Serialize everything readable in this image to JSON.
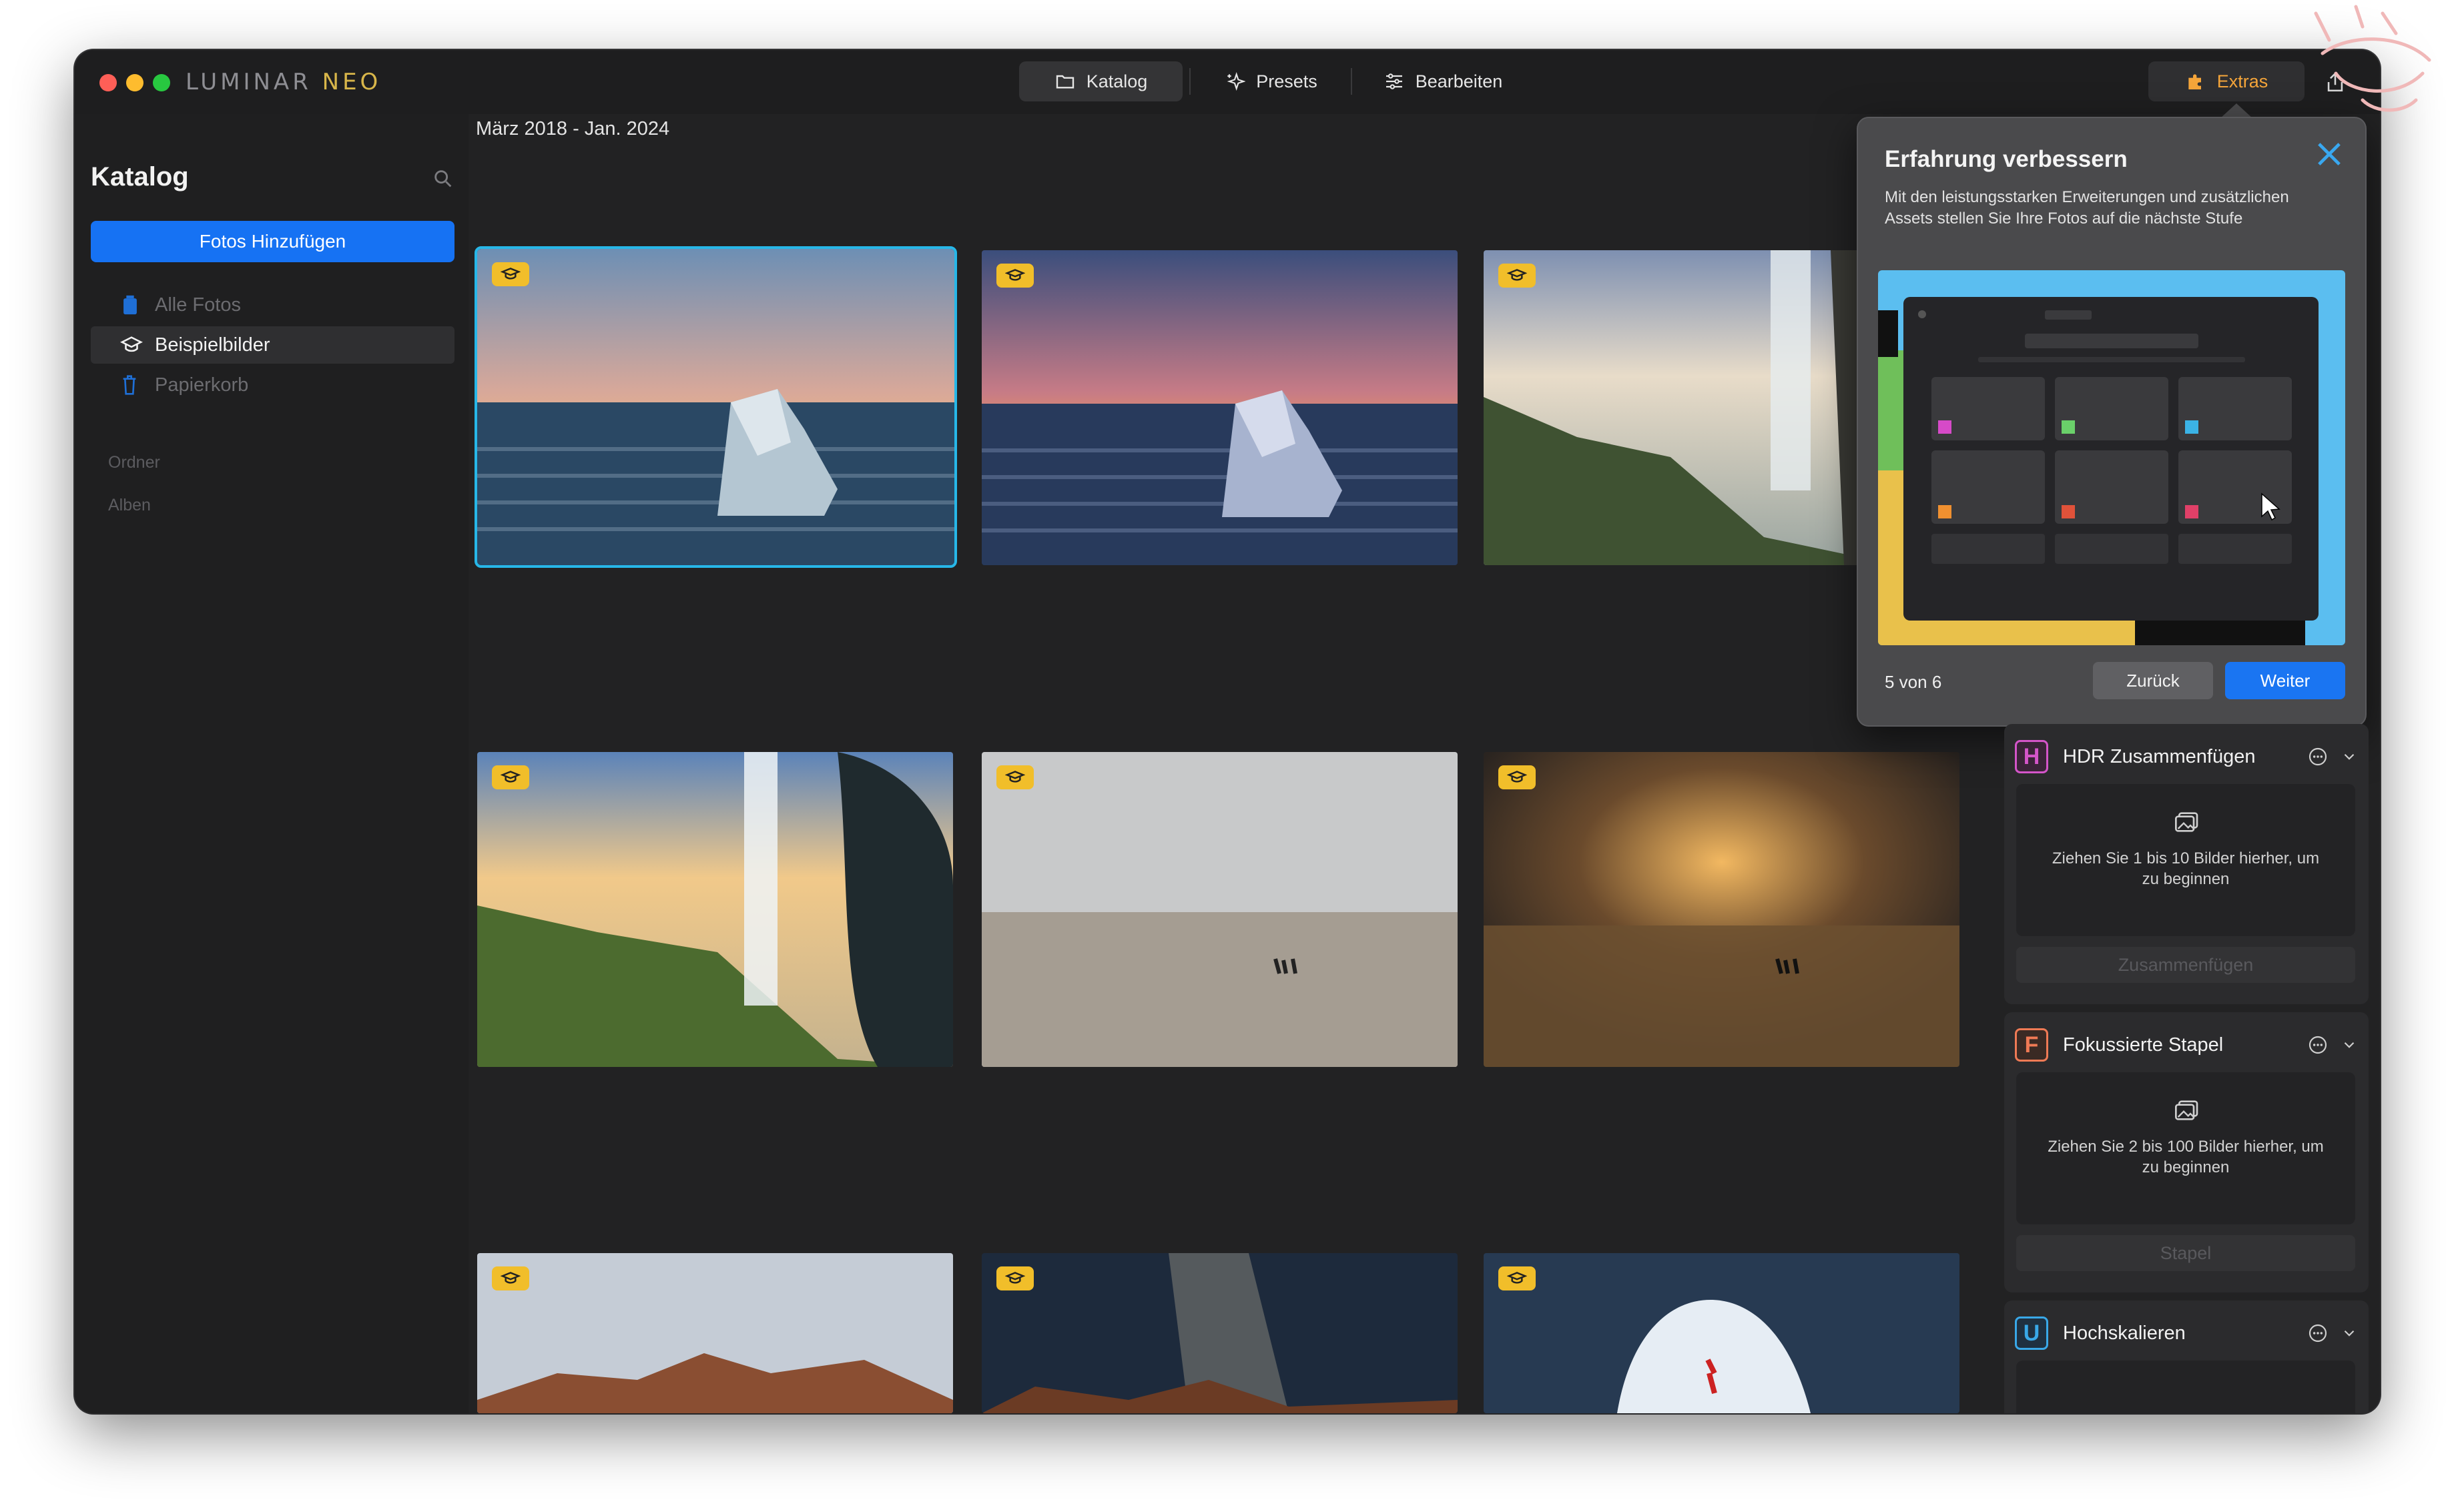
{
  "app": {
    "logo_main": "LUMINAR",
    "logo_accent": "NEO"
  },
  "topnav": {
    "katalog": "Katalog",
    "presets": "Presets",
    "bearbeiten": "Bearbeiten",
    "extras": "Extras"
  },
  "sidebar": {
    "title": "Katalog",
    "add_button": "Fotos Hinzufügen",
    "items": [
      {
        "label": "Alle Fotos"
      },
      {
        "label": "Beispielbilder"
      },
      {
        "label": "Papierkorb"
      }
    ],
    "sections": {
      "ordner": "Ordner",
      "alben": "Alben"
    }
  },
  "main": {
    "date_range": "März 2018 - Jan. 2024"
  },
  "popup": {
    "title": "Erfahrung verbessern",
    "description": "Mit den leistungsstarken Erweiterungen und zusätzlichen Assets stellen Sie Ihre Fotos auf die nächste Stufe",
    "step": "5 von 6",
    "back": "Zurück",
    "next": "Weiter"
  },
  "extensions": [
    {
      "letter": "H",
      "title": "HDR Zusammenfügen",
      "drop": "Ziehen Sie 1 bis 10 Bilder hierher, um zu beginnen",
      "button": "Zusammenfügen",
      "color": "#d455c9"
    },
    {
      "letter": "F",
      "title": "Fokussierte Stapel",
      "drop": "Ziehen Sie 2 bis 100 Bilder hierher, um zu beginnen",
      "button": "Stapel",
      "color": "#ef7a55"
    },
    {
      "letter": "U",
      "title": "Hochskalieren",
      "color": "#39a8e8"
    }
  ],
  "colors": {
    "accent_blue": "#1672f3",
    "selection": "#27b7e8",
    "extras_orange": "#f5a53a",
    "badge_yellow": "#f1be2a"
  }
}
